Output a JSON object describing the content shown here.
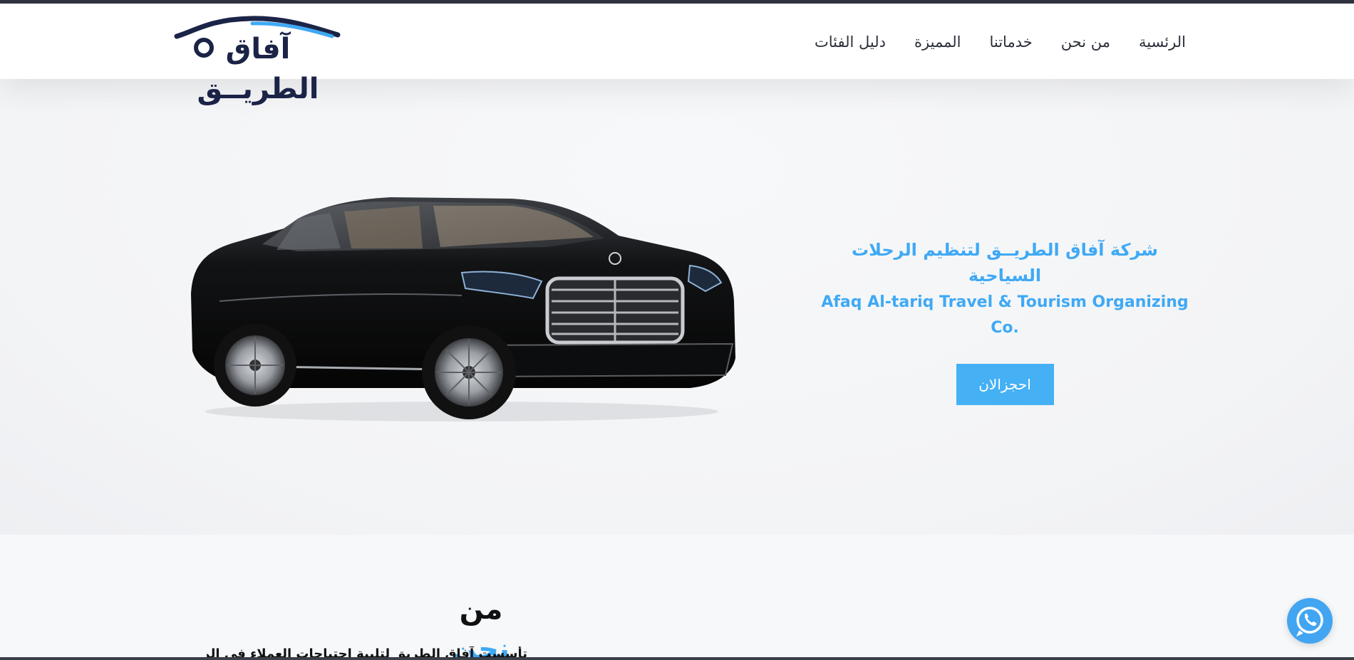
{
  "header": {
    "logo_text": "آفاق الطريــق",
    "nav": [
      {
        "label": "الرئسية"
      },
      {
        "label": "من نحن"
      },
      {
        "label": "خدماتنا"
      },
      {
        "label": "المميزة"
      },
      {
        "label": "دليل الفئات"
      }
    ]
  },
  "hero": {
    "title_ar": "شركة آفاق الطريــق لتنظيم الرحلات السياحية",
    "title_en": "Afaq Al-tariq Travel & Tourism Organizing Co.",
    "button_label": "احجزالان",
    "car_image_icon": "car-image"
  },
  "about": {
    "title_word1": "من",
    "title_word2": "نحن",
    "intro_text": "تأسست آفاق الطريق لتلبية احتياجات العملاء في المملكة"
  },
  "widgets": {
    "whatsapp_icon": "whatsapp-icon"
  },
  "colors": {
    "accent": "#3fa9f5",
    "navy": "#1b2447",
    "topbar": "#2f3341"
  }
}
